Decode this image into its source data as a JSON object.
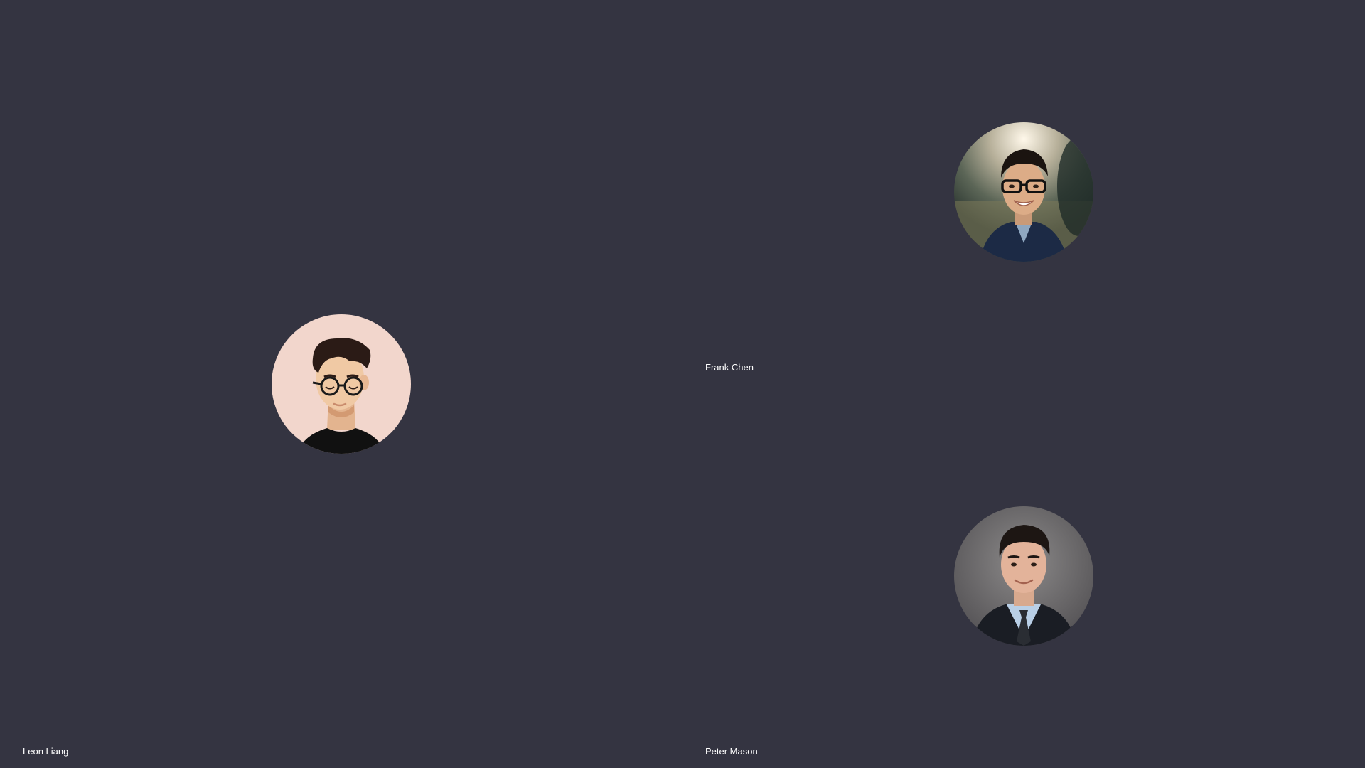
{
  "participants": [
    {
      "name": "Leon Liang",
      "avatar_icon": "illustrated-avatar-icon",
      "avatar_bg": "#f2d6cc"
    },
    {
      "name": "Frank Chen",
      "avatar_icon": "photo-avatar-icon"
    },
    {
      "name": "Peter Mason",
      "avatar_icon": "photo-avatar-icon"
    }
  ],
  "colors": {
    "stage_background": "#343441",
    "label_text": "#ffffff"
  }
}
